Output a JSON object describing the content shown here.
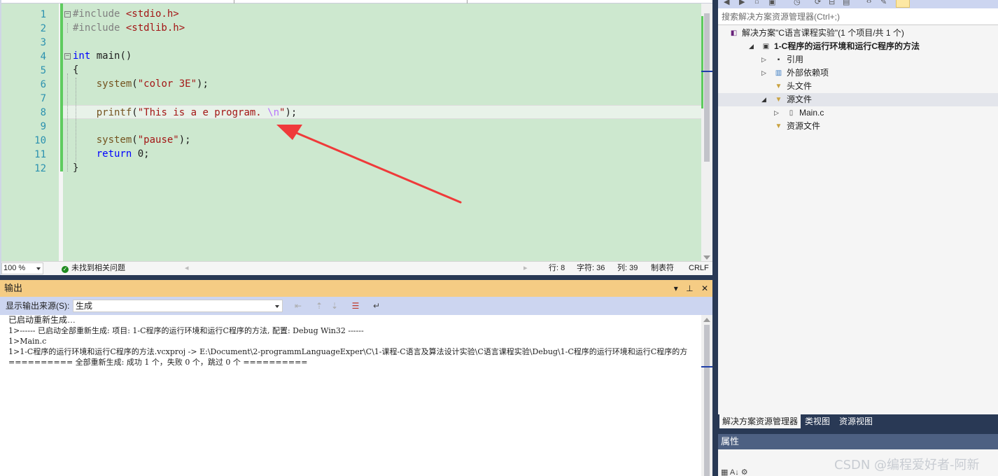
{
  "colors": {
    "editor_bg": "#cde8cf",
    "output_title_bg": "#f5cc84",
    "keyword": "#0000ff",
    "string": "#a31515",
    "annotation_arrow": "#ef3a3a"
  },
  "editor": {
    "lines": [
      {
        "n": "1",
        "parts": [
          {
            "c": "pp",
            "t": "#include "
          },
          {
            "c": "inc",
            "t": "<stdio.h>"
          }
        ]
      },
      {
        "n": "2",
        "parts": [
          {
            "c": "pp",
            "t": "#include "
          },
          {
            "c": "inc",
            "t": "<stdlib.h>"
          }
        ]
      },
      {
        "n": "3",
        "parts": []
      },
      {
        "n": "4",
        "parts": [
          {
            "c": "kw",
            "t": "int"
          },
          {
            "c": "tx",
            "t": " main()"
          }
        ]
      },
      {
        "n": "5",
        "parts": [
          {
            "c": "tx",
            "t": "{"
          }
        ]
      },
      {
        "n": "6",
        "parts": [
          {
            "c": "tx",
            "t": "    "
          },
          {
            "c": "fn",
            "t": "system"
          },
          {
            "c": "tx",
            "t": "("
          },
          {
            "c": "str",
            "t": "\"color 3E\""
          },
          {
            "c": "tx",
            "t": ");"
          }
        ]
      },
      {
        "n": "7",
        "parts": []
      },
      {
        "n": "8",
        "parts": [
          {
            "c": "tx",
            "t": "    "
          },
          {
            "c": "fn",
            "t": "printf"
          },
          {
            "c": "tx",
            "t": "("
          },
          {
            "c": "str",
            "t": "\"This is a e program. "
          },
          {
            "c": "esc",
            "t": "\\n"
          },
          {
            "c": "str",
            "t": "\""
          },
          {
            "c": "tx",
            "t": ");"
          }
        ]
      },
      {
        "n": "9",
        "parts": []
      },
      {
        "n": "10",
        "parts": [
          {
            "c": "tx",
            "t": "    "
          },
          {
            "c": "fn",
            "t": "system"
          },
          {
            "c": "tx",
            "t": "("
          },
          {
            "c": "str",
            "t": "\"pause\""
          },
          {
            "c": "tx",
            "t": ");"
          }
        ]
      },
      {
        "n": "11",
        "parts": [
          {
            "c": "tx",
            "t": "    "
          },
          {
            "c": "kw",
            "t": "return"
          },
          {
            "c": "tx",
            "t": " 0;"
          }
        ]
      },
      {
        "n": "12",
        "parts": [
          {
            "c": "tx",
            "t": "}"
          }
        ]
      }
    ],
    "fold_marker": "−"
  },
  "statusbar": {
    "zoom": "100 %",
    "issues": "未找到相关问题",
    "line": "行: 8",
    "char": "字符: 36",
    "col": "列: 39",
    "indent": "制表符",
    "eol": "CRLF"
  },
  "output": {
    "title": "输出",
    "source_label": "显示输出来源(S):",
    "source_value": "生成",
    "lines": [
      "已启动重新生成…",
      "1>------ 已启动全部重新生成: 项目: 1-C程序的运行环境和运行C程序的方法, 配置: Debug Win32 ------",
      "1>Main.c",
      "1>1-C程序的运行环境和运行C程序的方法.vcxproj -> E:\\Document\\2-programmLanguageExper\\C\\1-课程-C语言及算法设计实验\\C语言课程实验\\Debug\\1-C程序的运行环境和运行C程序的方",
      "========== 全部重新生成: 成功 1 个，失败 0 个，跳过 0 个 =========="
    ]
  },
  "solution_explorer": {
    "search_placeholder": "搜索解决方案资源管理器(Ctrl+;)",
    "items": [
      {
        "label": "解决方案\"C语言课程实验\"(1 个项目/共 1 个)",
        "icon": "solution-icon",
        "indent": 0,
        "arrow": "",
        "bold": false
      },
      {
        "label": "1-C程序的运行环境和运行C程序的方法",
        "icon": "project-icon",
        "indent": 1,
        "arrow": "◢",
        "bold": true
      },
      {
        "label": "引用",
        "icon": "references-icon",
        "indent": 2,
        "arrow": "▷",
        "bold": false
      },
      {
        "label": "外部依赖项",
        "icon": "external-deps-icon",
        "indent": 2,
        "arrow": "▷",
        "bold": false
      },
      {
        "label": "头文件",
        "icon": "filter-folder-icon",
        "indent": 2,
        "arrow": "",
        "bold": false
      },
      {
        "label": "源文件",
        "icon": "filter-folder-icon",
        "indent": 2,
        "arrow": "◢",
        "bold": false,
        "selected": true
      },
      {
        "label": "Main.c",
        "icon": "c-file-icon",
        "indent": 3,
        "arrow": "▷",
        "bold": false
      },
      {
        "label": "资源文件",
        "icon": "filter-folder-icon",
        "indent": 2,
        "arrow": "",
        "bold": false
      }
    ],
    "tabs": [
      "解决方案资源管理器",
      "类视图",
      "资源视图"
    ]
  },
  "properties": {
    "title": "属性"
  },
  "watermark": "CSDN @编程爱好者-阿新"
}
